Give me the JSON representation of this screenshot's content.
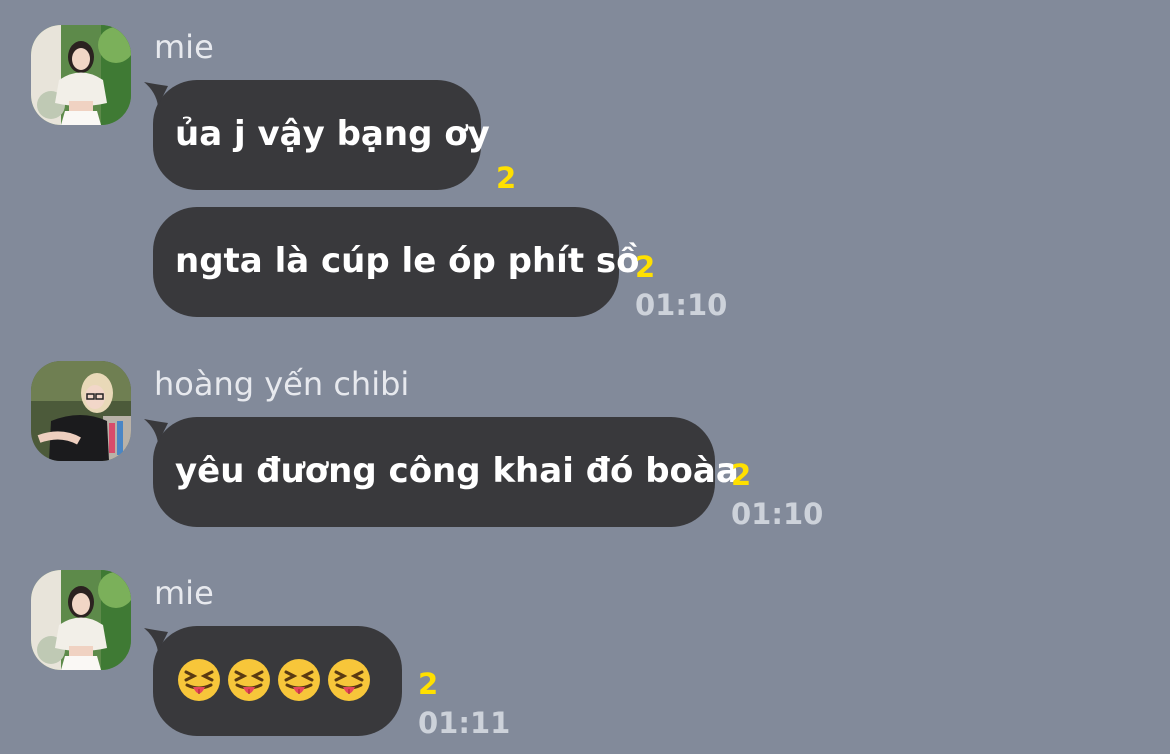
{
  "messages": [
    {
      "sender": "mie",
      "bubbles": [
        {
          "text": "ủa j vậy bạng ơy",
          "read_count": "2",
          "time": ""
        },
        {
          "text": "ngta là cúp le óp phít sồ",
          "read_count": "2",
          "time": "01:10"
        }
      ]
    },
    {
      "sender": "hoàng yến chibi",
      "bubbles": [
        {
          "text": "yêu đương công khai đó boàa",
          "read_count": "2",
          "time": "01:10"
        }
      ]
    },
    {
      "sender": "mie",
      "bubbles": [
        {
          "text": "",
          "emojis": [
            "squinting-face-with-tongue",
            "squinting-face-with-tongue",
            "squinting-face-with-tongue",
            "squinting-face-with-tongue"
          ],
          "read_count": "2",
          "time": "01:11"
        }
      ]
    }
  ],
  "colors": {
    "background": "#828a9a",
    "bubble": "#39393c",
    "read_count": "#ffe000",
    "time": "#cdd2da",
    "name": "#e7e9ee"
  }
}
